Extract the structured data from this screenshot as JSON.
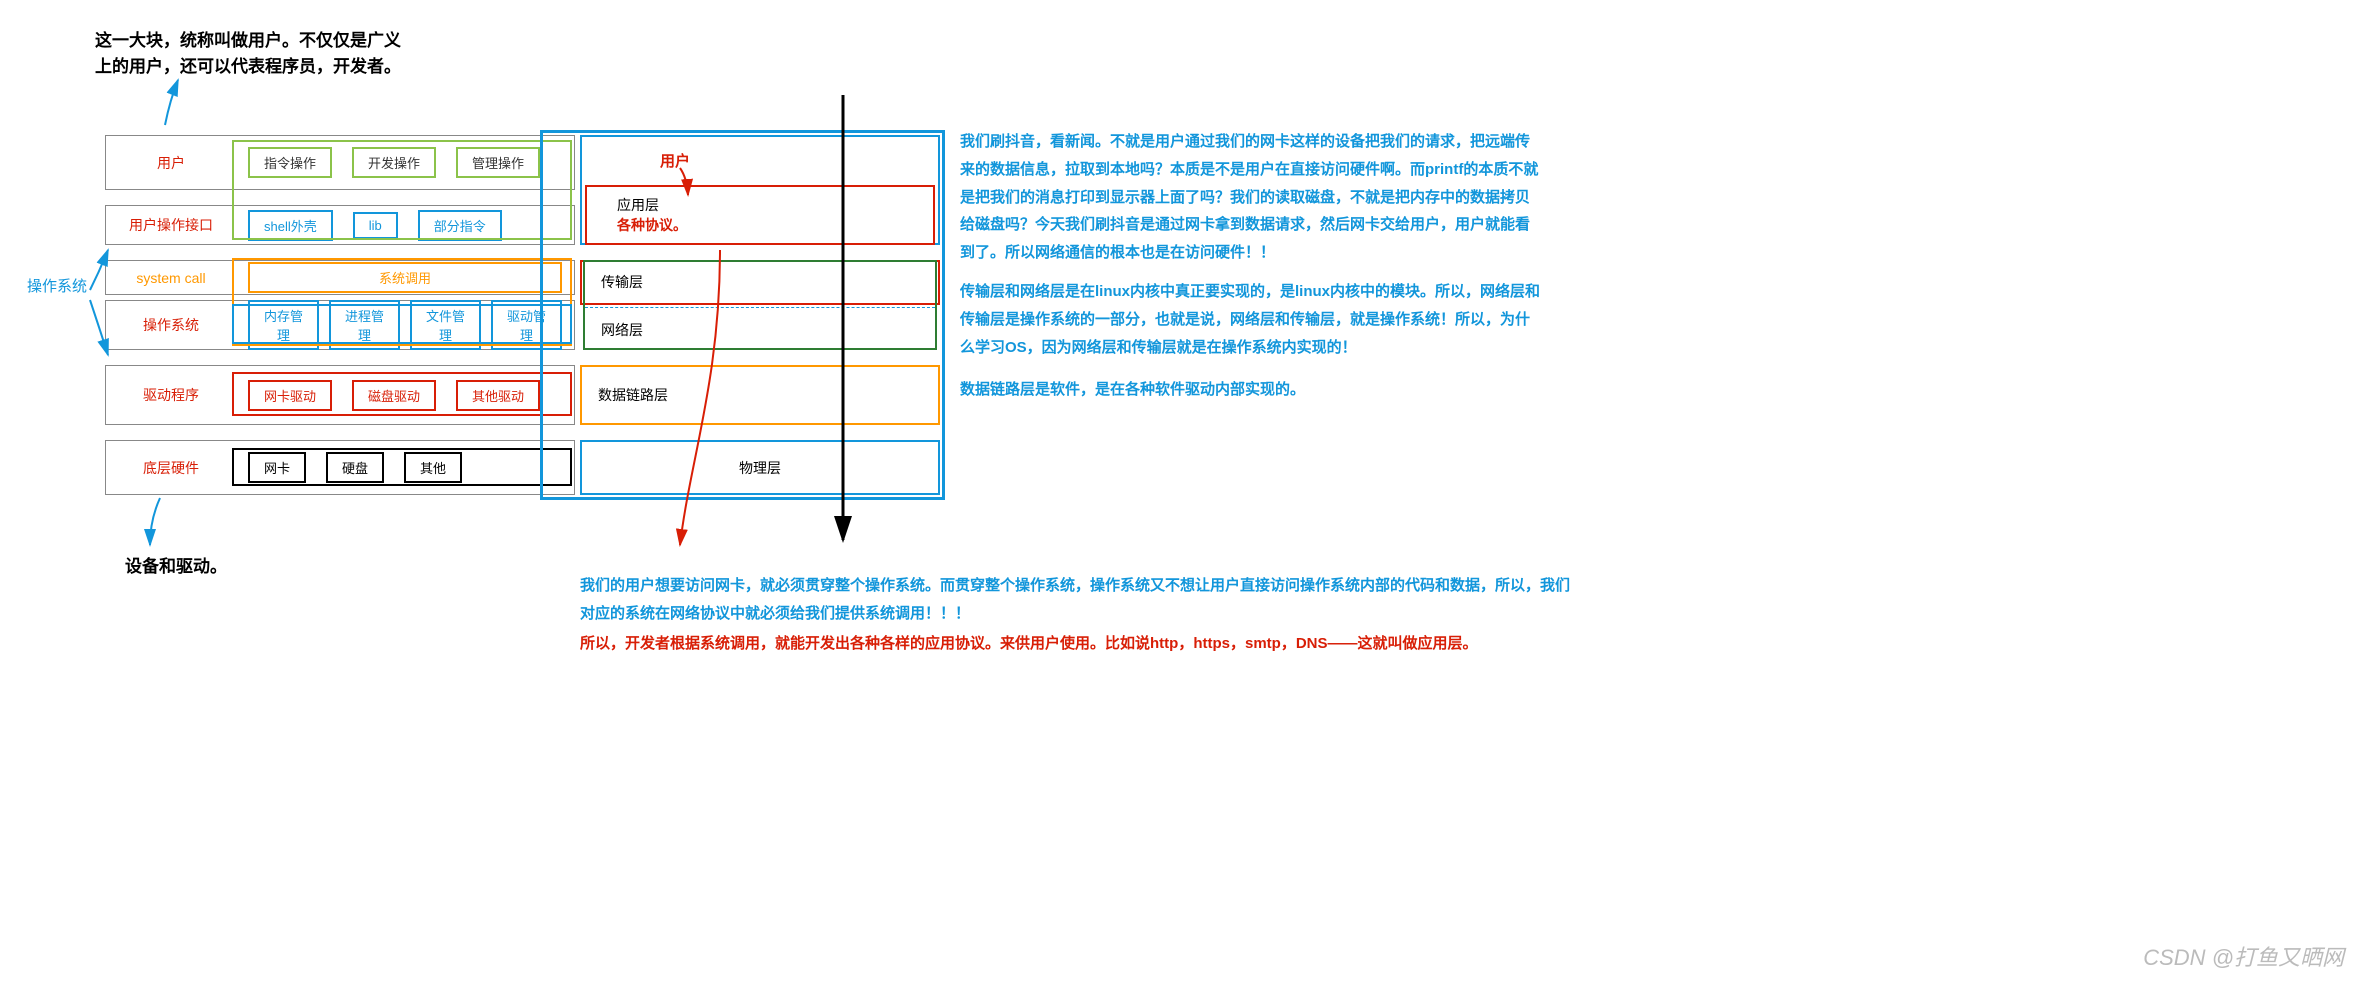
{
  "heading": {
    "line1": "这一大块，统称叫做用户。不仅仅是广义",
    "line2": "上的用户，还可以代表程序员，开发者。"
  },
  "osLabel": "操作系统",
  "bottomLabel": "设备和驱动。",
  "rows": {
    "user": {
      "label": "用户",
      "boxes": [
        "指令操作",
        "开发操作",
        "管理操作"
      ]
    },
    "interface": {
      "label": "用户操作接口",
      "boxes": [
        "shell外壳",
        "lib",
        "部分指令"
      ]
    },
    "syscall": {
      "label": "system call",
      "wide": "系统调用"
    },
    "os": {
      "label": "操作系统",
      "boxes": [
        "内存管理",
        "进程管理",
        "文件管理",
        "驱动管理"
      ]
    },
    "driver": {
      "label": "驱动程序",
      "boxes": [
        "网卡驱动",
        "磁盘驱动",
        "其他驱动"
      ]
    },
    "hw": {
      "label": "底层硬件",
      "boxes": [
        "网卡",
        "硬盘",
        "其他"
      ]
    }
  },
  "userRed": "用户",
  "netLayers": {
    "app": {
      "label": "应用层",
      "sub": "各种协议。"
    },
    "trans": "传输层",
    "net": "网络层",
    "link": "数据链路层",
    "phys": "物理层"
  },
  "anno1": "我们刷抖音，看新闻。不就是用户通过我们的网卡这样的设备把我们的请求，把远端传来的数据信息，拉取到本地吗？本质是不是用户在直接访问硬件啊。而printf的本质不就是把我们的消息打印到显示器上面了吗？我们的读取磁盘，不就是把内存中的数据拷贝给磁盘吗？今天我们刷抖音是通过网卡拿到数据请求，然后网卡交给用户，用户就能看到了。所以网络通信的根本也是在访问硬件！！",
  "anno2": "传输层和网络层是在linux内核中真正要实现的，是linux内核中的模块。所以，网络层和传输层是操作系统的一部分，也就是说，网络层和传输层，就是操作系统！所以，为什么学习OS，因为网络层和传输层就是在操作系统内实现的！",
  "anno3": "数据链路层是软件，是在各种软件驱动内部实现的。",
  "bottom1": "我们的用户想要访问网卡，就必须贯穿整个操作系统。而贯穿整个操作系统，操作系统又不想让用户直接访问操作系统内部的代码和数据，所以，我们对应的系统在网络协议中就必须给我们提供系统调用！！！",
  "bottom2": "所以，开发者根据系统调用，就能开发出各种各样的应用协议。来供用户使用。比如说http，https，smtp，DNS——这就叫做应用层。",
  "watermark": "CSDN @打鱼又晒网"
}
